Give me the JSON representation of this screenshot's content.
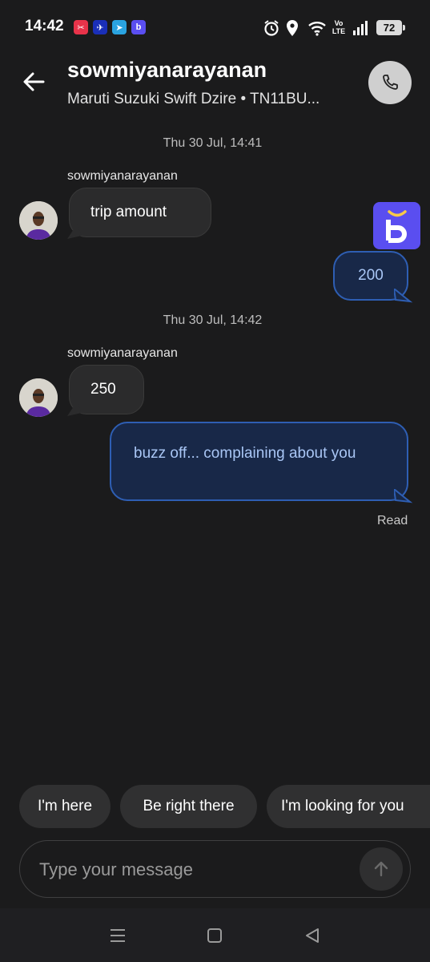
{
  "status_bar": {
    "time": "14:42",
    "battery": "72",
    "network": "Vo LTE",
    "app_icons": [
      "scissors-app-icon",
      "plane-app-icon",
      "telegram-icon",
      "ride-app-icon"
    ],
    "system_icons": [
      "alarm-icon",
      "location-icon",
      "wifi-icon",
      "signal-icon",
      "battery-icon"
    ]
  },
  "header": {
    "title": "sowmiyanarayanan",
    "subtitle": "Maruti Suzuki Swift Dzire • TN11BU..."
  },
  "messages": {
    "date_1": "Thu 30 Jul, 14:41",
    "sender_1": "sowmiyanarayanan",
    "in_1": "trip amount",
    "out_1": "200",
    "date_2": "Thu 30 Jul, 14:42",
    "sender_2": "sowmiyanarayanan",
    "in_2": "250",
    "out_2": "buzz off... complaining about you",
    "read_status": "Read"
  },
  "quick_replies": [
    "I'm here",
    "Be right there",
    "I'm looking for you"
  ],
  "composer": {
    "placeholder": "Type your message"
  },
  "colors": {
    "background": "#1b1b1c",
    "outgoing_bubble": "#182848",
    "outgoing_border": "#2e5eb3",
    "outgoing_text": "#a9c6f5",
    "incoming_bubble": "#2b2b2c",
    "brand": "#5a4ef0"
  }
}
